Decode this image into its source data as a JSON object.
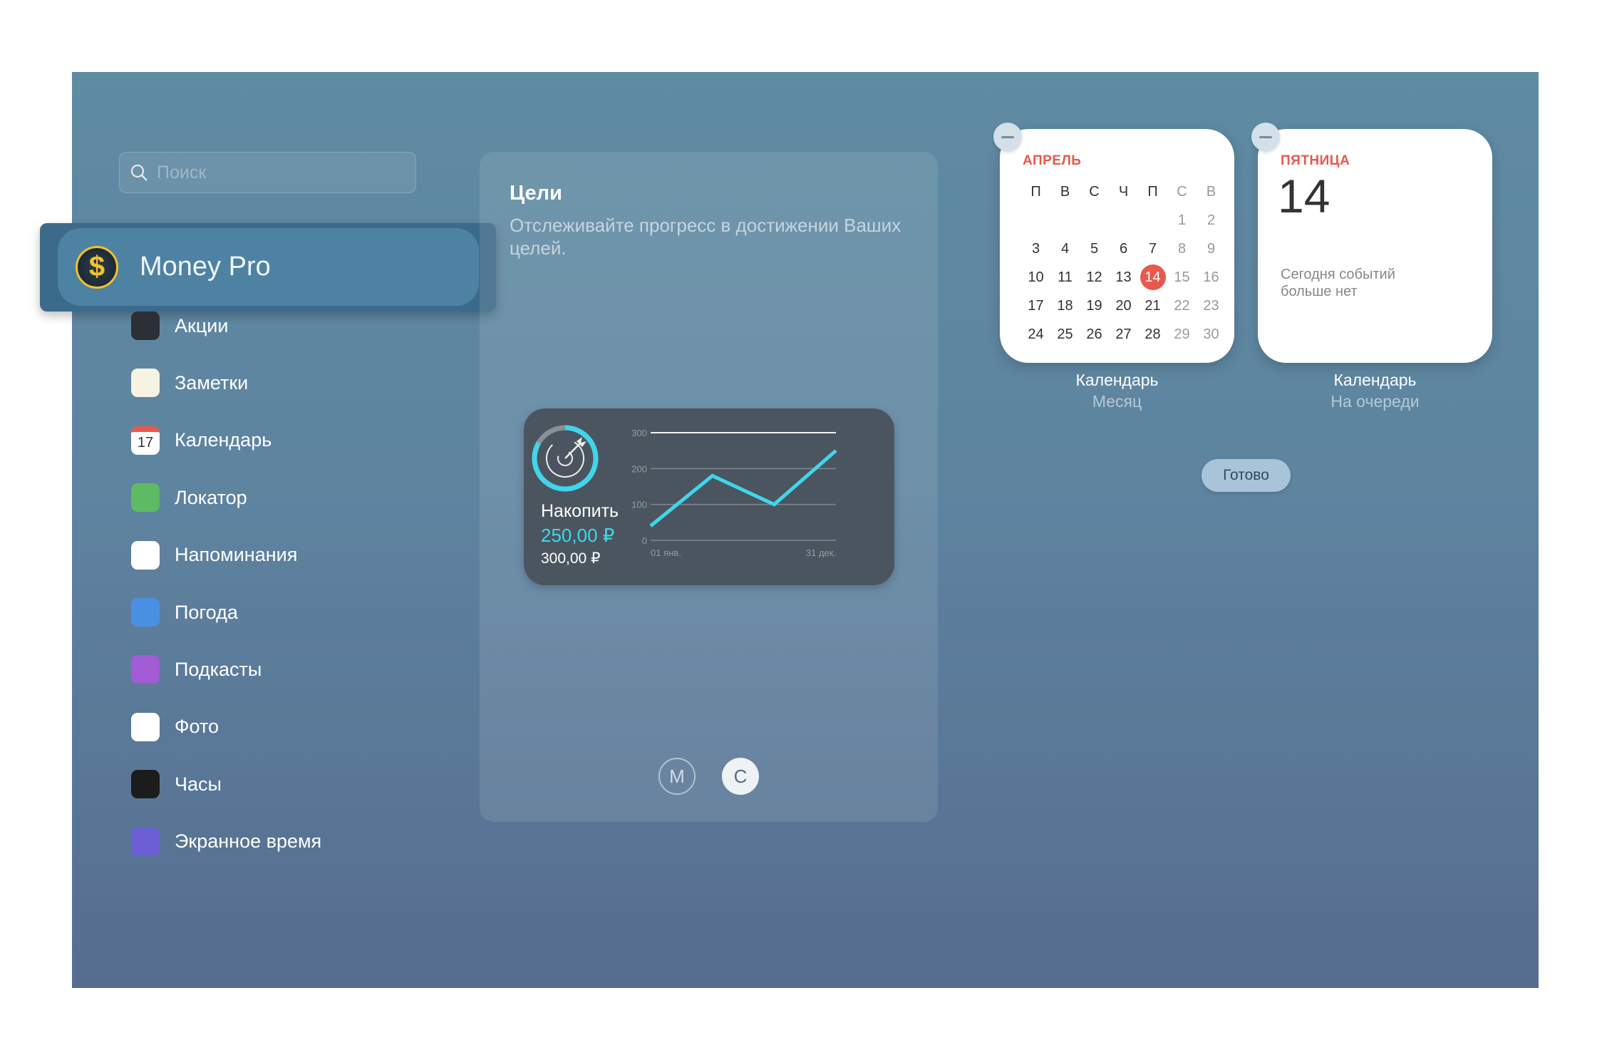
{
  "search": {
    "placeholder": "Поиск"
  },
  "selected_app": {
    "name": "Money Pro",
    "icon": "dollar-coin-icon"
  },
  "apps": [
    {
      "label": "Акции",
      "icon": "stocks-icon",
      "color": "#2b2f36"
    },
    {
      "label": "Заметки",
      "icon": "notes-icon",
      "color": "#f7f3e3"
    },
    {
      "label": "Календарь",
      "icon": "calendar-icon",
      "color": "#ffffff",
      "glyph": "17"
    },
    {
      "label": "Локатор",
      "icon": "find-my-icon",
      "color": "#5dbb63"
    },
    {
      "label": "Напоминания",
      "icon": "reminders-icon",
      "color": "#ffffff"
    },
    {
      "label": "Погода",
      "icon": "weather-icon",
      "color": "#4a90e2"
    },
    {
      "label": "Подкасты",
      "icon": "podcasts-icon",
      "color": "#a35bd6"
    },
    {
      "label": "Фото",
      "icon": "photos-icon",
      "color": "#ffffff"
    },
    {
      "label": "Часы",
      "icon": "clock-icon",
      "color": "#1c1c1c"
    },
    {
      "label": "Экранное время",
      "icon": "hourglass-icon",
      "color": "#6c5fd6"
    }
  ],
  "preview": {
    "title": "Цели",
    "subtitle": "Отслеживайте прогресс в достижении Ваших целей.",
    "goal_label": "Накопить",
    "current": "250,00 ₽",
    "target": "300,00 ₽",
    "progress": 0.833,
    "accent": "#3fd6ec",
    "sizes": [
      "M",
      "C"
    ],
    "selected_size": "C"
  },
  "chart_data": {
    "type": "line",
    "x_labels": [
      "01 янв.",
      "31 дек."
    ],
    "y_ticks": [
      0,
      100,
      200,
      300
    ],
    "ylim": [
      0,
      300
    ],
    "goal_line": 300,
    "values": [
      40,
      180,
      100,
      250
    ],
    "grid": true
  },
  "widgets": [
    {
      "month": "АПРЕЛЬ",
      "weekdays": [
        "П",
        "В",
        "С",
        "Ч",
        "П",
        "С",
        "В"
      ],
      "first_offset": 5,
      "days": 30,
      "today": 14,
      "name": "Календарь",
      "kind": "Месяц"
    },
    {
      "weekday": "ПЯТНИЦА",
      "day": "14",
      "note": "Сегодня событий больше нет",
      "name": "Календарь",
      "kind": "На очереди"
    }
  ],
  "done_label": "Готово"
}
